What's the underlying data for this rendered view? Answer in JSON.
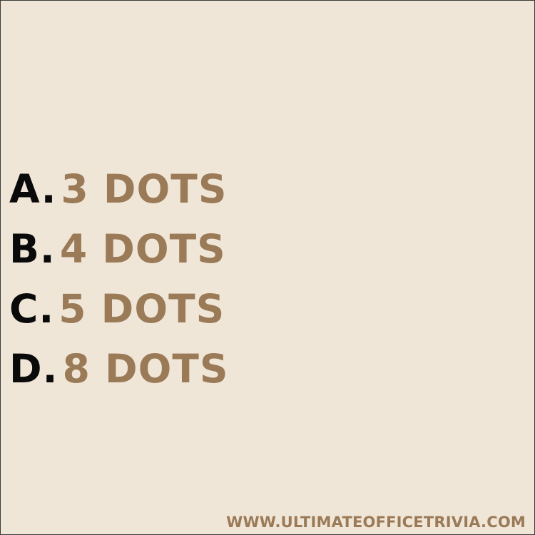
{
  "options": [
    {
      "letter": "A.",
      "text": "3 DOTS"
    },
    {
      "letter": "B.",
      "text": "4 DOTS"
    },
    {
      "letter": "C.",
      "text": "5 DOTS"
    },
    {
      "letter": "D.",
      "text": "8 DOTS"
    }
  ],
  "footer": {
    "url": "WWW.ULTIMATEOFFICETRIVIA.COM"
  },
  "colors": {
    "background": "#f0e6d7",
    "letter": "#0a0a0a",
    "answer": "#9a7a57"
  }
}
